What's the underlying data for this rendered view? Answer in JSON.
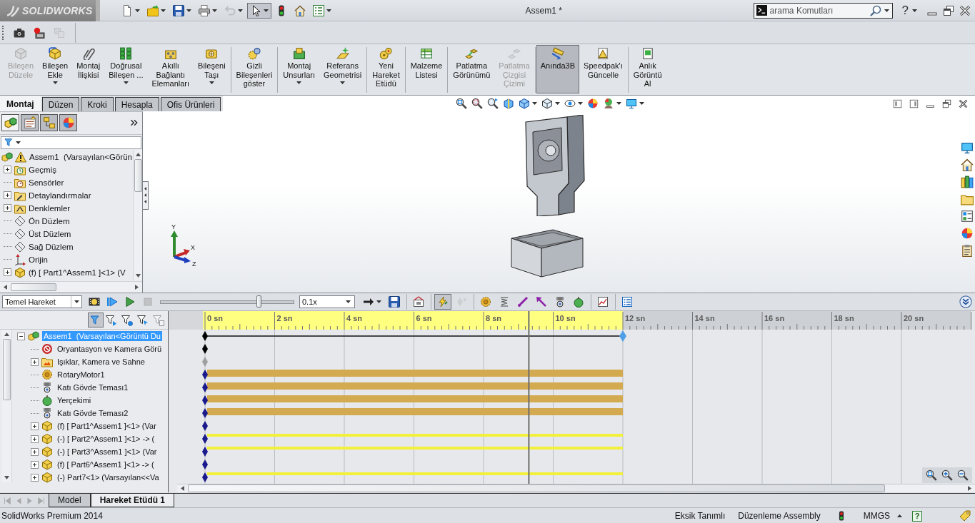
{
  "window": {
    "logo": "SOLIDWORKS",
    "title": "Assem1 *",
    "help": "?"
  },
  "quick_access": [
    {
      "dropdown": true,
      "disabled": false,
      "selected": false
    },
    {
      "dropdown": true,
      "disabled": false,
      "selected": false
    },
    {
      "dropdown": true,
      "disabled": false,
      "selected": false
    },
    {
      "dropdown": true,
      "disabled": false,
      "selected": false
    },
    {
      "dropdown": true,
      "disabled": true,
      "selected": false
    },
    {
      "dropdown": true,
      "disabled": false,
      "selected": true
    },
    {
      "dropdown": false,
      "disabled": false,
      "selected": false
    },
    {
      "dropdown": false,
      "disabled": false,
      "selected": false
    },
    {
      "dropdown": true,
      "disabled": false,
      "selected": false
    }
  ],
  "search": {
    "placeholder": "arama Komutları"
  },
  "capture_tools": [
    {
      "disabled": false
    },
    {
      "disabled": false
    },
    {
      "disabled": true
    }
  ],
  "ribbon": {
    "groups": [
      [
        {
          "lines": [
            "Bileşen",
            "Düzele"
          ],
          "dropdown": false,
          "disabled": true,
          "selected": false
        },
        {
          "lines": [
            "Bileşen",
            "Ekle"
          ],
          "dropdown": true,
          "disabled": false,
          "selected": false
        },
        {
          "lines": [
            "Montaj",
            "İlişkisi"
          ],
          "dropdown": false,
          "disabled": false,
          "selected": false
        },
        {
          "lines": [
            "Doğrusal",
            "Bileşen ..."
          ],
          "dropdown": true,
          "disabled": false,
          "selected": false
        },
        {
          "lines": [
            "Akıllı",
            "Bağlantı",
            "Elemanları"
          ],
          "dropdown": false,
          "disabled": false,
          "selected": false
        },
        {
          "lines": [
            "Bileşeni",
            "Taşı"
          ],
          "dropdown": true,
          "disabled": false,
          "selected": false
        }
      ],
      [
        {
          "lines": [
            "Gizli",
            "Bileşenleri",
            "göster"
          ],
          "dropdown": false,
          "disabled": false,
          "selected": false
        }
      ],
      [
        {
          "lines": [
            "Montaj",
            "Unsurları"
          ],
          "dropdown": true,
          "disabled": false,
          "selected": false
        },
        {
          "lines": [
            "Referans",
            "Geometrisi"
          ],
          "dropdown": true,
          "disabled": false,
          "selected": false
        }
      ],
      [
        {
          "lines": [
            "Yeni",
            "Hareket",
            "Etüdü"
          ],
          "dropdown": false,
          "disabled": false,
          "selected": false
        }
      ],
      [
        {
          "lines": [
            "Malzeme",
            "Listesi"
          ],
          "dropdown": false,
          "disabled": false,
          "selected": false
        }
      ],
      [
        {
          "lines": [
            "Patlatma",
            "Görünümü"
          ],
          "dropdown": false,
          "disabled": false,
          "selected": false
        },
        {
          "lines": [
            "Patlatma",
            "Çizgisi",
            "Çizimi"
          ],
          "dropdown": false,
          "disabled": true,
          "selected": false
        }
      ],
      [
        {
          "lines": [
            "Anında3B"
          ],
          "dropdown": false,
          "disabled": false,
          "selected": true
        },
        {
          "lines": [
            "Speedpak'ı",
            "Güncelle"
          ],
          "dropdown": false,
          "disabled": false,
          "selected": false
        }
      ],
      [
        {
          "lines": [
            "Anlık",
            "Görüntü",
            "Al"
          ],
          "dropdown": false,
          "disabled": false,
          "selected": false
        }
      ]
    ]
  },
  "command_tabs": [
    {
      "label": "Montaj",
      "selected": true
    },
    {
      "label": "Düzen",
      "selected": false
    },
    {
      "label": "Kroki",
      "selected": false
    },
    {
      "label": "Hesapla",
      "selected": false
    },
    {
      "label": "Ofis Ürünleri",
      "selected": false
    }
  ],
  "feature_manager": {
    "tabs": [
      {
        "selected": true
      },
      {
        "selected": false
      },
      {
        "selected": false
      },
      {
        "selected": false
      }
    ],
    "tree": {
      "label": "Assem1  (Varsayılan<Görün",
      "warning": true,
      "children": [
        {
          "label": "Geçmiş",
          "expanded": false
        },
        {
          "label": "Sensörler"
        },
        {
          "label": "Detaylandırmalar",
          "expanded": false
        },
        {
          "label": "Denklemler",
          "expanded": false
        },
        {
          "label": "Ön Düzlem"
        },
        {
          "label": "Üst Düzlem"
        },
        {
          "label": "Sağ Düzlem"
        },
        {
          "label": "Orijin"
        },
        {
          "label": "(f) [ Part1^Assem1 ]<1> (V",
          "expanded": false
        }
      ]
    }
  },
  "viewport": {
    "triad_axes": [
      "Y",
      "X",
      "Z"
    ]
  },
  "motion_manager": {
    "study_type": "Temel Hareket",
    "controls": [
      {
        "disabled": false
      },
      {
        "disabled": false
      },
      {
        "disabled": false
      },
      {
        "disabled": true
      }
    ],
    "playback": {
      "level": 0.74
    },
    "speed": "0.1x",
    "tool_groups": [
      [
        {
          "dropdown": true,
          "disabled": false,
          "selected": false
        },
        {
          "dropdown": false,
          "disabled": false,
          "selected": false
        }
      ],
      [
        {
          "dropdown": false,
          "disabled": false,
          "selected": false
        }
      ],
      [
        {
          "dropdown": false,
          "disabled": false,
          "selected": true
        },
        {
          "dropdown": false,
          "disabled": true,
          "selected": false
        }
      ],
      [
        {
          "dropdown": false,
          "disabled": false,
          "selected": false
        },
        {
          "dropdown": false,
          "disabled": false,
          "selected": false
        },
        {
          "dropdown": false,
          "disabled": false,
          "selected": false
        },
        {
          "dropdown": false,
          "disabled": false,
          "selected": false
        },
        {
          "dropdown": false,
          "disabled": false,
          "selected": false
        },
        {
          "dropdown": false,
          "disabled": false,
          "selected": false
        }
      ],
      [
        {
          "dropdown": false,
          "disabled": false,
          "selected": false
        }
      ],
      [
        {
          "dropdown": false,
          "disabled": false,
          "selected": false
        }
      ]
    ],
    "filters": [
      {
        "selected": true,
        "disabled": false
      },
      {
        "selected": false,
        "disabled": false
      },
      {
        "selected": false,
        "disabled": false
      },
      {
        "selected": false,
        "disabled": false
      },
      {
        "selected": false,
        "disabled": true
      }
    ],
    "tree": {
      "label": "Assem1  (Varsayılan<Görüntü Du",
      "selected": true,
      "expanded": true,
      "color": "#000000",
      "kind": "line",
      "children": [
        {
          "label": "Oryantasyon ve Kamera Görü",
          "selected": false,
          "color": "#000000",
          "kind": "none"
        },
        {
          "label": "Işıklar, Kamera ve Sahne",
          "selected": false,
          "expanded": false,
          "color": "#a0a0a0",
          "kind": "none"
        },
        {
          "label": "RotaryMotor1",
          "selected": false,
          "color": "#1a1a8c",
          "kind": "band"
        },
        {
          "label": "Katı Gövde Teması1",
          "selected": false,
          "color": "#1a1a8c",
          "kind": "band"
        },
        {
          "label": "Yerçekimi",
          "selected": false,
          "color": "#1a1a8c",
          "kind": "band"
        },
        {
          "label": "Katı Gövde Teması2",
          "selected": false,
          "color": "#1a1a8c",
          "kind": "band"
        },
        {
          "label": "(f) [ Part1^Assem1 ]<1> (Var",
          "selected": false,
          "expanded": false,
          "color": "#1a1a8c",
          "kind": "none"
        },
        {
          "label": "(-) [ Part2^Assem1 ]<1> -> (",
          "selected": false,
          "expanded": false,
          "color": "#1a1a8c",
          "kind": "strip"
        },
        {
          "label": "(-) [ Part3^Assem1 ]<1> (Var",
          "selected": false,
          "expanded": false,
          "color": "#1a1a8c",
          "kind": "strip"
        },
        {
          "label": "(f) [ Part6^Assem1 ]<1> -> (",
          "selected": false,
          "expanded": false,
          "color": "#1a1a8c",
          "kind": "none"
        },
        {
          "label": "(-) Part7<1> (Varsayılan<<Va",
          "selected": false,
          "expanded": false,
          "color": "#1a1a8c",
          "kind": "strip"
        }
      ]
    },
    "timeline": {
      "ticks": [
        {
          "label": "0 sn",
          "active": true
        },
        {
          "label": "2 sn",
          "active": true
        },
        {
          "label": "4 sn",
          "active": true
        },
        {
          "label": "6 sn",
          "active": true
        },
        {
          "label": "8 sn",
          "active": true
        },
        {
          "label": "10 sn",
          "active": true
        },
        {
          "label": "12 sn",
          "active": false
        },
        {
          "label": "14 sn",
          "active": false
        },
        {
          "label": "16 sn",
          "active": false
        },
        {
          "label": "18 sn",
          "active": false
        },
        {
          "label": "20 sn",
          "active": false
        }
      ],
      "cursor": {
        "level": 0.775
      }
    }
  },
  "study_tabs": [
    {
      "label": "Model",
      "selected": false
    },
    {
      "label": "Hareket Etüdü 1",
      "selected": true
    }
  ],
  "status_bar": {
    "product": "SolidWorks Premium 2014",
    "definition": "Eksik Tanımlı",
    "mode": "Düzenleme Assembly",
    "units": "MMGS",
    "help": "?"
  }
}
